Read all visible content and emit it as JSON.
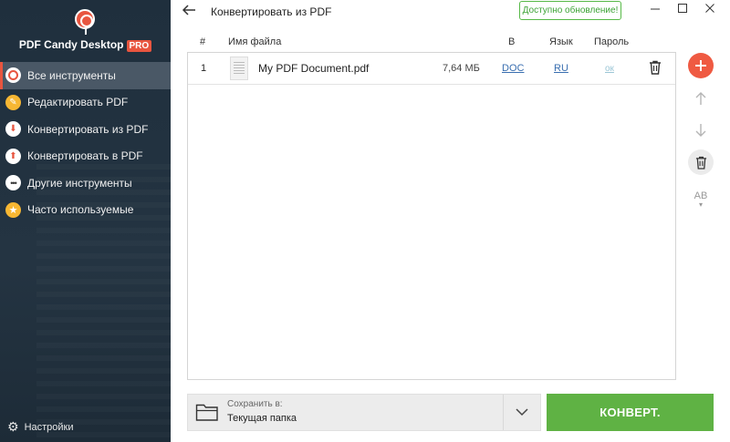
{
  "sidebar": {
    "brand": "PDF Candy Desktop",
    "pro_badge": "PRO",
    "items": [
      {
        "label": "Все инструменты"
      },
      {
        "label": "Редактировать PDF"
      },
      {
        "label": "Конвертировать из PDF"
      },
      {
        "label": "Конвертировать в PDF"
      },
      {
        "label": "Другие инструменты"
      },
      {
        "label": "Часто используемые"
      }
    ],
    "settings_label": "Настройки"
  },
  "header": {
    "title": "Конвертировать из PDF",
    "update_label": "Доступно обновление!"
  },
  "table": {
    "columns": {
      "num": "#",
      "name": "Имя файла",
      "to": "В",
      "lang": "Язык",
      "password": "Пароль"
    },
    "rows": [
      {
        "num": "1",
        "name": "My PDF Document.pdf",
        "size": "7,64 МБ",
        "format": "DOC",
        "lang": "RU",
        "password": "ок"
      }
    ]
  },
  "side_buttons": {
    "ab_label": "AB"
  },
  "save": {
    "label": "Сохранить в:",
    "value": "Текущая папка"
  },
  "convert_label": "КОНВЕРТ.",
  "colors": {
    "accent": "#ef5a42",
    "convert": "#5fb244",
    "sidebar": "#243442",
    "link": "#3a6fb0"
  }
}
